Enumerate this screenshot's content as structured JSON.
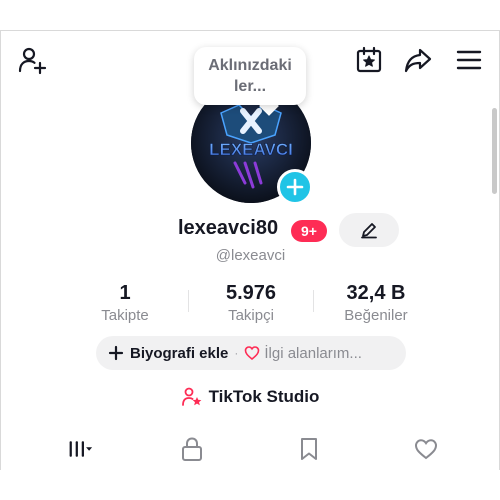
{
  "header": {
    "icons": [
      "add-friend-icon",
      "calendar-star-icon",
      "share-icon",
      "menu-icon"
    ]
  },
  "tooltip": {
    "text": "Aklınızdaki ler..."
  },
  "profile": {
    "avatar_logo_text": "LEXEAVCI",
    "username": "lexeavci80",
    "notification_badge": "9+",
    "handle": "@lexeavci"
  },
  "stats": {
    "following": {
      "value": "1",
      "label": "Takipte"
    },
    "followers": {
      "value": "5.976",
      "label": "Takipçi"
    },
    "likes": {
      "value": "32,4 B",
      "label": "Beğeniler"
    }
  },
  "bio": {
    "add_label": "Biyografi ekle",
    "separator": "·",
    "interests_label": "İlgi alanlarım..."
  },
  "studio": {
    "label": "TikTok Studio"
  },
  "tabs": [
    "videos-grid-icon",
    "lock-icon",
    "bookmark-icon",
    "heart-icon"
  ],
  "colors": {
    "accent_red": "#fe2c55",
    "accent_cyan": "#20c4e6",
    "text_primary": "#161823",
    "text_secondary": "#8a8b91",
    "pill_bg": "#f1f1f2",
    "logo_blue": "#3f6fe0",
    "logo_purple": "#8c3bd9"
  }
}
